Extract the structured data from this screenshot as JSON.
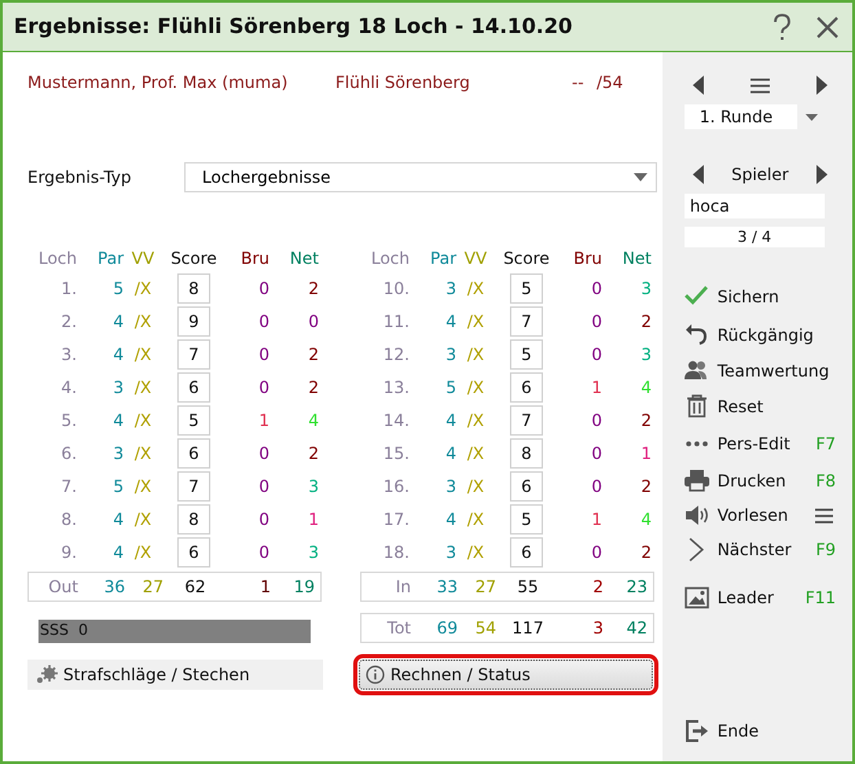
{
  "window": {
    "title": "Ergebnisse: Flühli Sörenberg 18 Loch - 14.10.20"
  },
  "header": {
    "player": "Mustermann, Prof. Max (muma)",
    "course": "Flühli Sörenberg",
    "dashes": "--",
    "max": "/54"
  },
  "result_type": {
    "label": "Ergebnis-Typ",
    "value": "Lochergebnisse"
  },
  "front": {
    "columns": [
      "Loch",
      "Par",
      "VV",
      "Score",
      "Bru",
      "Net"
    ],
    "holes": [
      {
        "hole": "1.",
        "par": "5",
        "vv": "/X",
        "score": "8",
        "bru": {
          "text": "0",
          "color": "#800080"
        },
        "net": {
          "text": "2",
          "color": "#800000"
        }
      },
      {
        "hole": "2.",
        "par": "4",
        "vv": "/X",
        "score": "9",
        "bru": {
          "text": "0",
          "color": "#800080"
        },
        "net": {
          "text": "0",
          "color": "#800080"
        }
      },
      {
        "hole": "3.",
        "par": "4",
        "vv": "/X",
        "score": "7",
        "bru": {
          "text": "0",
          "color": "#800080"
        },
        "net": {
          "text": "2",
          "color": "#800000"
        }
      },
      {
        "hole": "4.",
        "par": "3",
        "vv": "/X",
        "score": "6",
        "bru": {
          "text": "0",
          "color": "#800080"
        },
        "net": {
          "text": "2",
          "color": "#800000"
        }
      },
      {
        "hole": "5.",
        "par": "4",
        "vv": "/X",
        "score": "5",
        "bru": {
          "text": "1",
          "color": "#e03050"
        },
        "net": {
          "text": "4",
          "color": "#30e030"
        }
      },
      {
        "hole": "6.",
        "par": "3",
        "vv": "/X",
        "score": "6",
        "bru": {
          "text": "0",
          "color": "#800080"
        },
        "net": {
          "text": "2",
          "color": "#800000"
        }
      },
      {
        "hole": "7.",
        "par": "5",
        "vv": "/X",
        "score": "7",
        "bru": {
          "text": "0",
          "color": "#800080"
        },
        "net": {
          "text": "3",
          "color": "#00b080"
        }
      },
      {
        "hole": "8.",
        "par": "4",
        "vv": "/X",
        "score": "8",
        "bru": {
          "text": "0",
          "color": "#800080"
        },
        "net": {
          "text": "1",
          "color": "#e0207f"
        }
      },
      {
        "hole": "9.",
        "par": "4",
        "vv": "/X",
        "score": "6",
        "bru": {
          "text": "0",
          "color": "#800080"
        },
        "net": {
          "text": "3",
          "color": "#00b080"
        }
      }
    ],
    "totals": [
      {
        "label": "Out",
        "par": "36",
        "vv": "27",
        "score": "62",
        "bru": {
          "text": "1",
          "color": "#600000"
        },
        "net": {
          "text": "19",
          "color": "#008060"
        }
      }
    ]
  },
  "back": {
    "columns": [
      "Loch",
      "Par",
      "VV",
      "Score",
      "Bru",
      "Net"
    ],
    "holes": [
      {
        "hole": "10.",
        "par": "3",
        "vv": "/X",
        "score": "5",
        "bru": {
          "text": "0",
          "color": "#800080"
        },
        "net": {
          "text": "3",
          "color": "#00b080"
        }
      },
      {
        "hole": "11.",
        "par": "4",
        "vv": "/X",
        "score": "7",
        "bru": {
          "text": "0",
          "color": "#800080"
        },
        "net": {
          "text": "2",
          "color": "#800000"
        }
      },
      {
        "hole": "12.",
        "par": "3",
        "vv": "/X",
        "score": "5",
        "bru": {
          "text": "0",
          "color": "#800080"
        },
        "net": {
          "text": "3",
          "color": "#00b080"
        }
      },
      {
        "hole": "13.",
        "par": "5",
        "vv": "/X",
        "score": "6",
        "bru": {
          "text": "1",
          "color": "#e03050"
        },
        "net": {
          "text": "4",
          "color": "#30e030"
        }
      },
      {
        "hole": "14.",
        "par": "4",
        "vv": "/X",
        "score": "7",
        "bru": {
          "text": "0",
          "color": "#800080"
        },
        "net": {
          "text": "2",
          "color": "#800000"
        }
      },
      {
        "hole": "15.",
        "par": "4",
        "vv": "/X",
        "score": "8",
        "bru": {
          "text": "0",
          "color": "#800080"
        },
        "net": {
          "text": "1",
          "color": "#e0207f"
        }
      },
      {
        "hole": "16.",
        "par": "3",
        "vv": "/X",
        "score": "6",
        "bru": {
          "text": "0",
          "color": "#800080"
        },
        "net": {
          "text": "2",
          "color": "#800000"
        }
      },
      {
        "hole": "17.",
        "par": "4",
        "vv": "/X",
        "score": "5",
        "bru": {
          "text": "1",
          "color": "#e03050"
        },
        "net": {
          "text": "4",
          "color": "#30e030"
        }
      },
      {
        "hole": "18.",
        "par": "3",
        "vv": "/X",
        "score": "6",
        "bru": {
          "text": "0",
          "color": "#800080"
        },
        "net": {
          "text": "2",
          "color": "#800000"
        }
      }
    ],
    "totals": [
      {
        "label": "In",
        "par": "33",
        "vv": "27",
        "score": "55",
        "bru": {
          "text": "2",
          "color": "#a00000"
        },
        "net": {
          "text": "23",
          "color": "#008060"
        }
      },
      {
        "label": "Tot",
        "par": "69",
        "vv": "54",
        "score": "117",
        "bru": {
          "text": "3",
          "color": "#a00000"
        },
        "net": {
          "text": "42",
          "color": "#008060"
        }
      }
    ]
  },
  "sss": "SSS  0",
  "penalty_button": "Strafschläge / Stechen",
  "calc_button": {
    "label": "Rechnen / Status",
    "highlighted": true
  },
  "sidebar": {
    "round": "1. Runde",
    "player_label": "Spieler",
    "player": "hoca",
    "counter": "3 / 4",
    "actions": [
      {
        "label": "Sichern"
      },
      {
        "label": "Rückgängig"
      },
      {
        "label": "Teamwertung"
      },
      {
        "label": "Reset"
      },
      {
        "label": "Pers-Edit",
        "shortcut": "F7"
      },
      {
        "label": "Drucken",
        "shortcut": "F8"
      },
      {
        "label": "Vorlesen"
      },
      {
        "label": "Nächster",
        "shortcut": "F9"
      },
      {
        "label": "Leader",
        "shortcut": "F11"
      }
    ],
    "exit": "Ende"
  }
}
